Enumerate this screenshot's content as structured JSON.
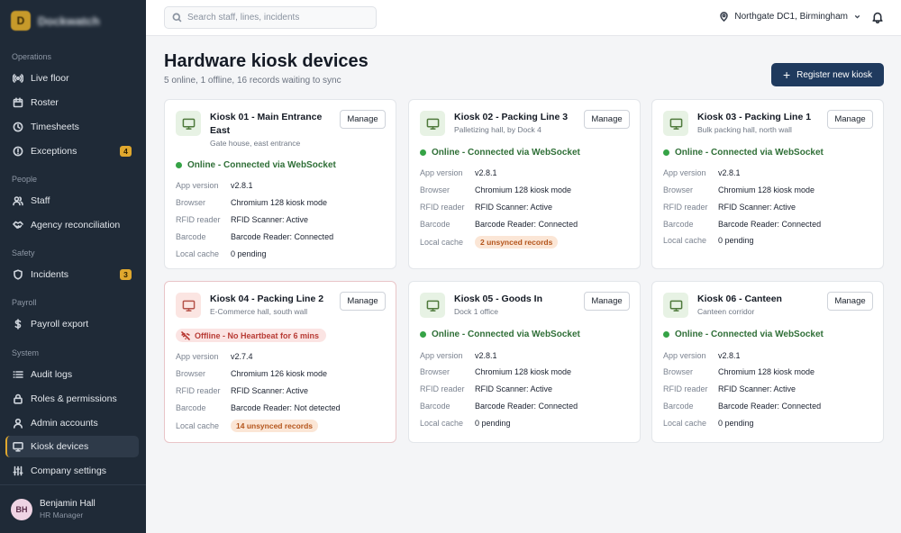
{
  "brand": {
    "name": "Dockwatch"
  },
  "sidebar": {
    "sections": [
      {
        "label": "Operations",
        "items": [
          {
            "label": "Live floor"
          },
          {
            "label": "Roster"
          },
          {
            "label": "Timesheets"
          },
          {
            "label": "Exceptions",
            "badge": "4"
          }
        ]
      },
      {
        "label": "People",
        "items": [
          {
            "label": "Staff"
          },
          {
            "label": "Agency reconciliation"
          }
        ]
      },
      {
        "label": "Safety",
        "items": [
          {
            "label": "Incidents",
            "badge": "3"
          }
        ]
      },
      {
        "label": "Payroll",
        "items": [
          {
            "label": "Payroll export"
          }
        ]
      },
      {
        "label": "System",
        "items": [
          {
            "label": "Audit logs"
          },
          {
            "label": "Roles & permissions"
          },
          {
            "label": "Admin accounts"
          },
          {
            "label": "Kiosk devices"
          },
          {
            "label": "Company settings"
          }
        ]
      }
    ],
    "active_item": "Kiosk devices"
  },
  "user": {
    "initials": "BH",
    "name": "Benjamin Hall",
    "role": "HR Manager"
  },
  "topbar": {
    "search_placeholder": "Search staff, lines, incidents",
    "location": "Northgate DC1, Birmingham"
  },
  "page": {
    "title": "Hardware kiosk devices",
    "subtitle": "5 online, 1 offline, 16 records waiting to sync",
    "register_button": "Register new kiosk"
  },
  "labels": {
    "manage": "Manage",
    "app_version": "App version",
    "browser": "Browser",
    "rfid": "RFID reader",
    "barcode": "Barcode",
    "local_cache": "Local cache"
  },
  "kiosks": [
    {
      "name": "Kiosk 01 - Main Entrance East",
      "location": "Gate house, east entrance",
      "status": "Online - Connected via WebSocket",
      "online": true,
      "app_version": "v2.8.1",
      "browser": "Chromium 128 kiosk mode",
      "rfid": "RFID Scanner: Active",
      "barcode": "Barcode Reader: Connected",
      "cache": "0 pending",
      "cache_warning": false
    },
    {
      "name": "Kiosk 02 - Packing Line 3",
      "location": "Palletizing hall, by Dock 4",
      "status": "Online - Connected via WebSocket",
      "online": true,
      "app_version": "v2.8.1",
      "browser": "Chromium 128 kiosk mode",
      "rfid": "RFID Scanner: Active",
      "barcode": "Barcode Reader: Connected",
      "cache": "2 unsynced records",
      "cache_warning": true
    },
    {
      "name": "Kiosk 03 - Packing Line 1",
      "location": "Bulk packing hall, north wall",
      "status": "Online - Connected via WebSocket",
      "online": true,
      "app_version": "v2.8.1",
      "browser": "Chromium 128 kiosk mode",
      "rfid": "RFID Scanner: Active",
      "barcode": "Barcode Reader: Connected",
      "cache": "0 pending",
      "cache_warning": false
    },
    {
      "name": "Kiosk 04 - Packing Line 2",
      "location": "E-Commerce hall, south wall",
      "status": "Offline - No Heartbeat for 6 mins",
      "online": false,
      "app_version": "v2.7.4",
      "browser": "Chromium 126 kiosk mode",
      "rfid": "RFID Scanner: Active",
      "barcode": "Barcode Reader: Not detected",
      "cache": "14 unsynced records",
      "cache_warning": true
    },
    {
      "name": "Kiosk 05 - Goods In",
      "location": "Dock 1 office",
      "status": "Online - Connected via WebSocket",
      "online": true,
      "app_version": "v2.8.1",
      "browser": "Chromium 128 kiosk mode",
      "rfid": "RFID Scanner: Active",
      "barcode": "Barcode Reader: Connected",
      "cache": "0 pending",
      "cache_warning": false
    },
    {
      "name": "Kiosk 06 - Canteen",
      "location": "Canteen corridor",
      "status": "Online - Connected via WebSocket",
      "online": true,
      "app_version": "v2.8.1",
      "browser": "Chromium 128 kiosk mode",
      "rfid": "RFID Scanner: Active",
      "barcode": "Barcode Reader: Connected",
      "cache": "0 pending",
      "cache_warning": false
    }
  ]
}
